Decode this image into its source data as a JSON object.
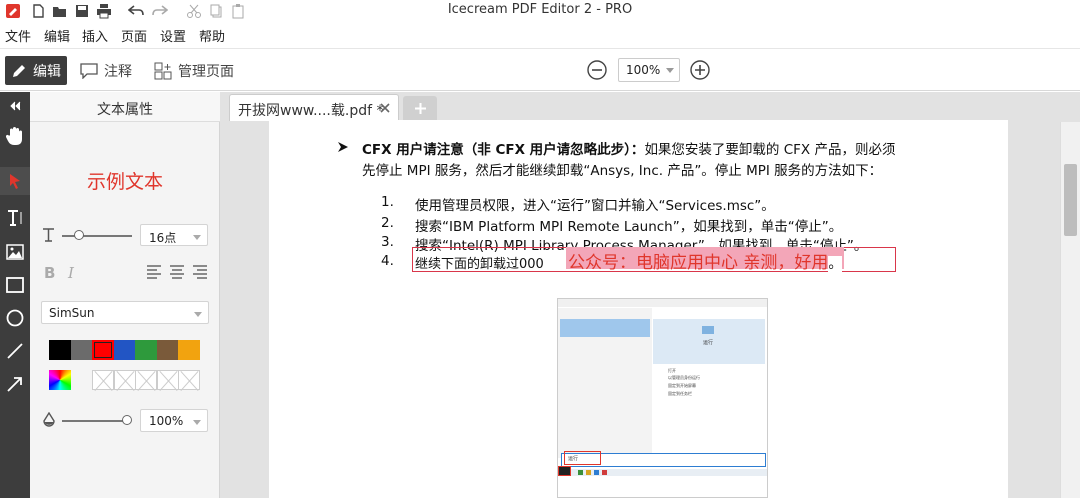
{
  "app": {
    "title": "Icecream PDF Editor 2",
    "title_suffix": "- PRO"
  },
  "menu": [
    "文件",
    "编辑",
    "插入",
    "页面",
    "设置",
    "帮助"
  ],
  "toolbar": {
    "modes": [
      {
        "label": "编辑",
        "icon": "pencil-icon",
        "active": true
      },
      {
        "label": "注释",
        "icon": "comment-icon",
        "active": false
      },
      {
        "label": "管理页面",
        "icon": "pages-icon",
        "active": false
      }
    ],
    "zoom": "100%"
  },
  "props": {
    "header": "文本属性",
    "sample": "示例文本",
    "font_size": "16点",
    "font_family": "SimSun",
    "opacity": "100%",
    "colors": [
      "#000000",
      "#6b6b6b",
      "#ff0000",
      "#2255c4",
      "#2e9a3c",
      "#7a5a3a",
      "#f2a30f"
    ]
  },
  "tabs": {
    "active": "开拔网www....载.pdf *"
  },
  "document": {
    "bullet_bold": "CFX 用户请注意（非 CFX 用户请忽略此步）：",
    "bullet_rest": "如果您安装了要卸载的 CFX 产品，则必须",
    "line2": "先停止 MPI 服务，然后才能继续卸载“Ansys, Inc. 产品”。停止 MPI 服务的方法如下：",
    "items": [
      {
        "num": "1.",
        "text": "使用管理员权限，进入“运行”窗口并输入“Services.msc”。"
      },
      {
        "num": "2.",
        "text": "搜索“IBM Platform MPI Remote Launch”，如果找到，单击“停止”。"
      },
      {
        "num": "3.",
        "text": "搜索“Intel(R) MPI Library Process Manager”，如果找到，单击“停止”。"
      },
      {
        "num": "4.",
        "text": "继续下面的卸载过000"
      }
    ],
    "highlight": "公众号：电脑应用中心 亲测，好用",
    "highlight_end": "。"
  },
  "embedded": {
    "panel_label": "运行",
    "search_text": "运行",
    "items": [
      "打开",
      "以管理员身份运行",
      "固定到开始屏幕",
      "固定到任务栏"
    ]
  }
}
